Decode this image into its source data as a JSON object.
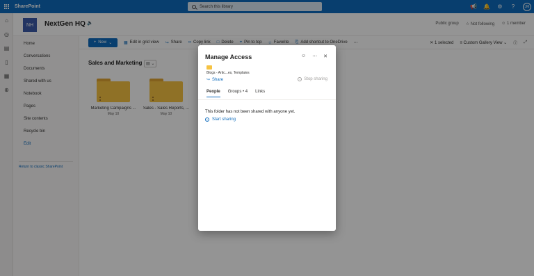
{
  "suite": {
    "app_name": "SharePoint",
    "search_placeholder": "Search this library",
    "user_initials": "JM"
  },
  "header": {
    "logo_initials": "NH",
    "site_title": "NextGen HQ",
    "group_label": "Public group",
    "follow_label": "Not following",
    "members_label": "1 member"
  },
  "nav": {
    "items": [
      "Home",
      "Conversations",
      "Documents",
      "Shared with us",
      "Notebook",
      "Pages",
      "Site contents",
      "Recycle bin"
    ],
    "edit_label": "Edit",
    "return_label": "Return to classic SharePoint"
  },
  "commandbar": {
    "new_label": "New",
    "commands": [
      "Edit in grid view",
      "Share",
      "Copy link",
      "Delete",
      "Pin to top",
      "Favorite",
      "Add shortcut to OneDrive"
    ],
    "selected_label": "1 selected",
    "view_label": "Custom Gallery View"
  },
  "library": {
    "title": "Sales and Marketing",
    "folders": [
      {
        "name": "Marketing Campaigns ...",
        "date": "May 10"
      },
      {
        "name": "Sales - Sales Reports, ...",
        "date": "May 10"
      }
    ]
  },
  "panel": {
    "title": "Manage Access",
    "path": "Blogs - Artic...es, Templates",
    "share_label": "Share",
    "stop_label": "Stop sharing",
    "tabs": [
      "People",
      "Groups • 4",
      "Links"
    ],
    "empty_message": "This folder has not been shared with anyone yet.",
    "start_label": "Start sharing"
  },
  "colors": {
    "suite_bar": "#0f6cbd",
    "accent": "#0f6cbd",
    "folder": "#f6c343",
    "logo_bg": "#3b5ba9"
  }
}
